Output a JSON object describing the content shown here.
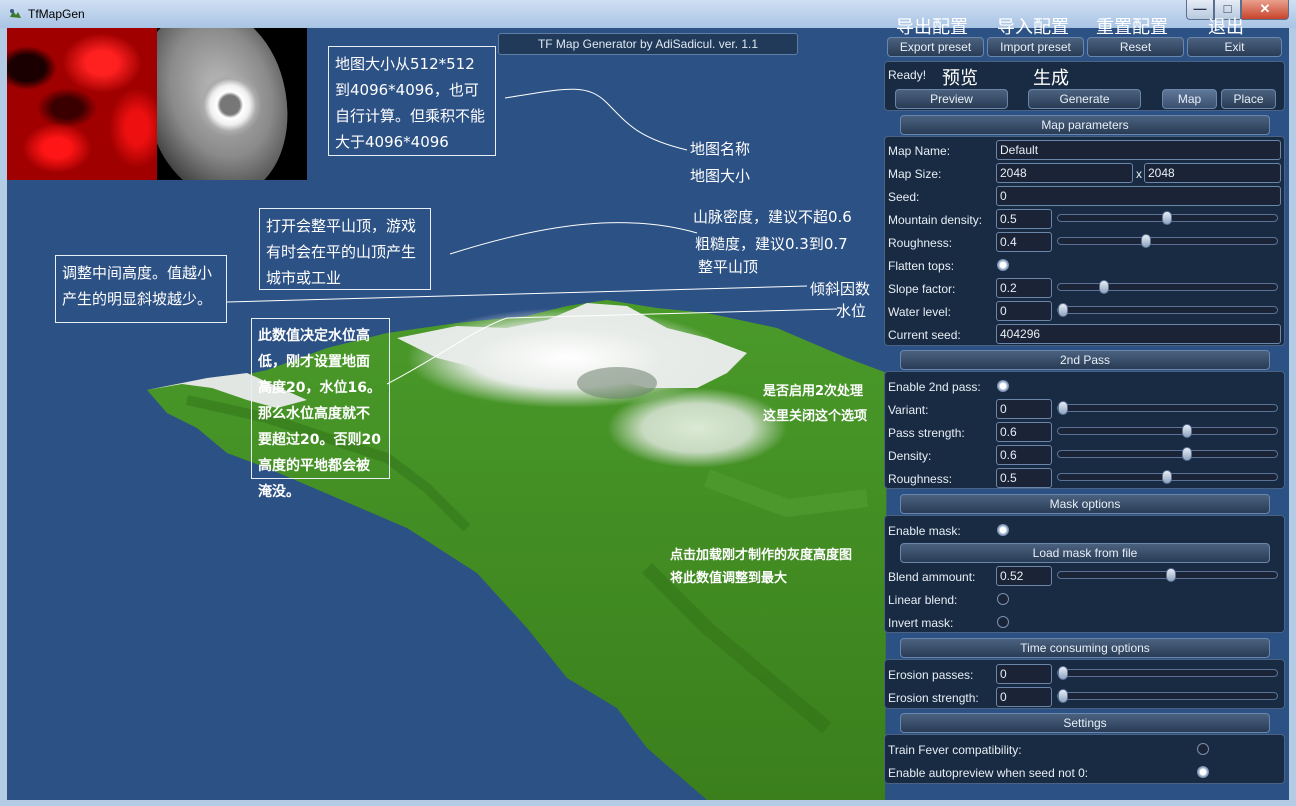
{
  "window": {
    "title": "TfMapGen",
    "controls": {
      "minimize": "—",
      "maximize": "□",
      "close": "✕"
    }
  },
  "app_label": "TF Map Generator by AdiSadicul. ver. 1.1",
  "toolbar": {
    "export_label": "Export preset",
    "import_label": "Import preset",
    "reset_label": "Reset",
    "exit_label": "Exit",
    "export_zh": "导出配置",
    "import_zh": "导入配置",
    "reset_zh": "重置配置",
    "exit_zh": "退出"
  },
  "status": {
    "text": "Ready!",
    "preview_zh": "预览",
    "generate_zh": "生成"
  },
  "actions": {
    "preview_label": "Preview",
    "generate_label": "Generate",
    "map_label": "Map",
    "place_label": "Place"
  },
  "map_params": {
    "header": "Map parameters",
    "name_label": "Map Name:",
    "name_value": "Default",
    "size_label": "Map Size:",
    "size_w": "2048",
    "size_x": "x",
    "size_h": "2048",
    "seed_label": "Seed:",
    "seed_value": "0",
    "mountain_label": "Mountain density:",
    "mountain_value": "0.5",
    "mountain_level": 0.5,
    "roughness_label": "Roughness:",
    "roughness_value": "0.4",
    "roughness_level": 0.4,
    "flatten_label": "Flatten tops:",
    "slope_label": "Slope factor:",
    "slope_value": "0.2",
    "slope_level": 0.2,
    "water_label": "Water level:",
    "water_value": "0",
    "water_level": 0,
    "current_seed_label": "Current seed:",
    "current_seed_value": "404296"
  },
  "second_pass": {
    "header": "2nd Pass",
    "enable_label": "Enable 2nd pass:",
    "variant_label": "Variant:",
    "variant_value": "0",
    "variant_level": 0,
    "strength_label": "Pass strength:",
    "strength_value": "0.6",
    "strength_level": 0.6,
    "density_label": "Density:",
    "density_value": "0.6",
    "density_level": 0.6,
    "roughness_label": "Roughness:",
    "roughness_value": "0.5",
    "roughness_level": 0.5
  },
  "mask": {
    "header": "Mask options",
    "enable_label": "Enable mask:",
    "load_label": "Load mask from file",
    "blend_label": "Blend ammount:",
    "blend_value": "0.52",
    "blend_level": 0.52,
    "linear_label": "Linear blend:",
    "invert_label": "Invert mask:"
  },
  "time": {
    "header": "Time consuming options",
    "erosion_passes_label": "Erosion passes:",
    "erosion_passes_value": "0",
    "erosion_passes_level": 0,
    "erosion_strength_label": "Erosion strength:",
    "erosion_strength_value": "0",
    "erosion_strength_level": 0
  },
  "settings": {
    "header": "Settings",
    "tf_label": "Train Fever compatibility:",
    "autopreview_label": "Enable autopreview when seed not 0:"
  },
  "notes": {
    "size_note": "地图大小从512*512到4096*4096，也可自行计算。但乘积不能大于4096*4096",
    "map_name": "地图名称",
    "map_size": "地图大小",
    "flatten_note": "打开会整平山顶，游戏有时会在平的山顶产生城市或工业",
    "mountain_note": "山脉密度，建议不超0.6",
    "roughness_note": "粗糙度，建议0.3到0.7",
    "flatten_tops": "整平山顶",
    "slope_note": "调整中间高度。值越小产生的明显斜坡越少。",
    "slope_factor": "倾斜因数",
    "water_level": "水位",
    "water_note": "此数值决定水位高低，刚才设置地面高度20，水位16。那么水位高度就不要超过20。否则20高度的平地都会被淹没。",
    "second_pass_note_1": "是否启用2次处理",
    "second_pass_note_2": "这里关闭这个选项",
    "mask_note_1": "点击加载刚才制作的灰度高度图",
    "mask_note_2": "将此数值调整到最大"
  },
  "colors": {
    "background": "#2c5185",
    "panel": "#18283e",
    "terrain_green": "#3f8f1f",
    "snow": "#f2f5f2"
  }
}
